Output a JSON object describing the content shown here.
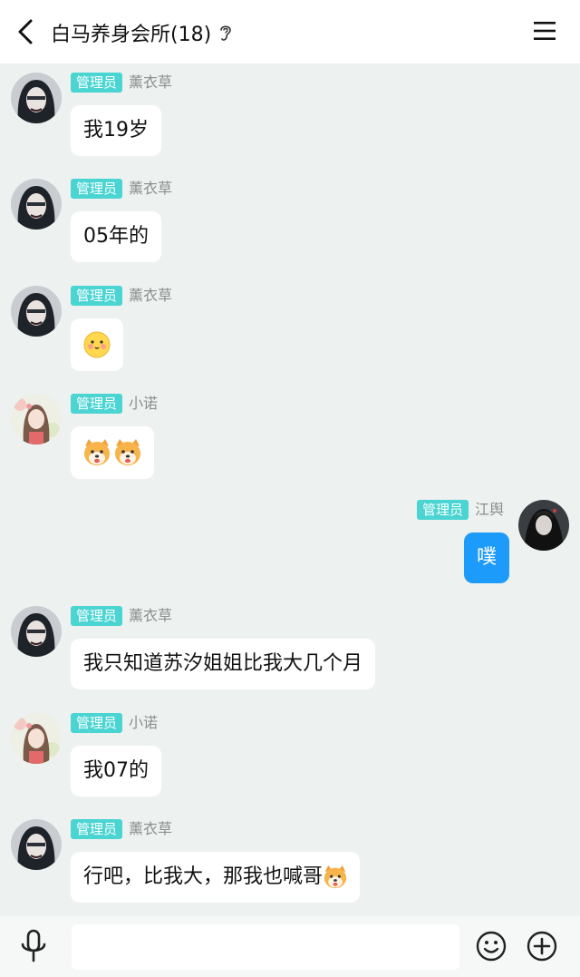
{
  "header": {
    "title": "白马养身会所(18)",
    "back_icon": "chevron-left-icon",
    "ear_icon": "ear-icon",
    "menu_icon": "hamburger-menu-icon"
  },
  "colors": {
    "badge": "#4ad4d2",
    "self_bubble": "#1d9bfa",
    "background": "#edf1ef"
  },
  "messages": [
    {
      "role": "管理员",
      "nick": "薰衣草",
      "text": "我19岁",
      "avatar": "avatar-dark-hair-girl"
    },
    {
      "role": "管理员",
      "nick": "薰衣草",
      "text": "05年的",
      "avatar": "avatar-dark-hair-girl"
    },
    {
      "role": "管理员",
      "nick": "薰衣草",
      "text": "",
      "sticker": "blush-face-emoji",
      "avatar": "avatar-dark-hair-girl"
    },
    {
      "role": "管理员",
      "nick": "小诺",
      "text": "",
      "sticker": "shiba-dog-emoji x2",
      "avatar": "avatar-flower-girl"
    },
    {
      "role": "管理员",
      "nick": "江舆",
      "text": "噗",
      "self": true,
      "avatar": "avatar-dark-cloak"
    },
    {
      "role": "管理员",
      "nick": "薰衣草",
      "text": "我只知道苏汐姐姐比我大几个月",
      "avatar": "avatar-dark-hair-girl"
    },
    {
      "role": "管理员",
      "nick": "小诺",
      "text": "我07的",
      "avatar": "avatar-flower-girl"
    },
    {
      "role": "管理员",
      "nick": "薰衣草",
      "text": "行吧，比我大，那我也喊哥",
      "sticker": "shiba-dog-emoji",
      "avatar": "avatar-dark-hair-girl"
    }
  ],
  "footer": {
    "mic_icon": "microphone-icon",
    "input_value": "",
    "emoji_icon": "smiley-icon",
    "plus_icon": "plus-circle-icon"
  }
}
